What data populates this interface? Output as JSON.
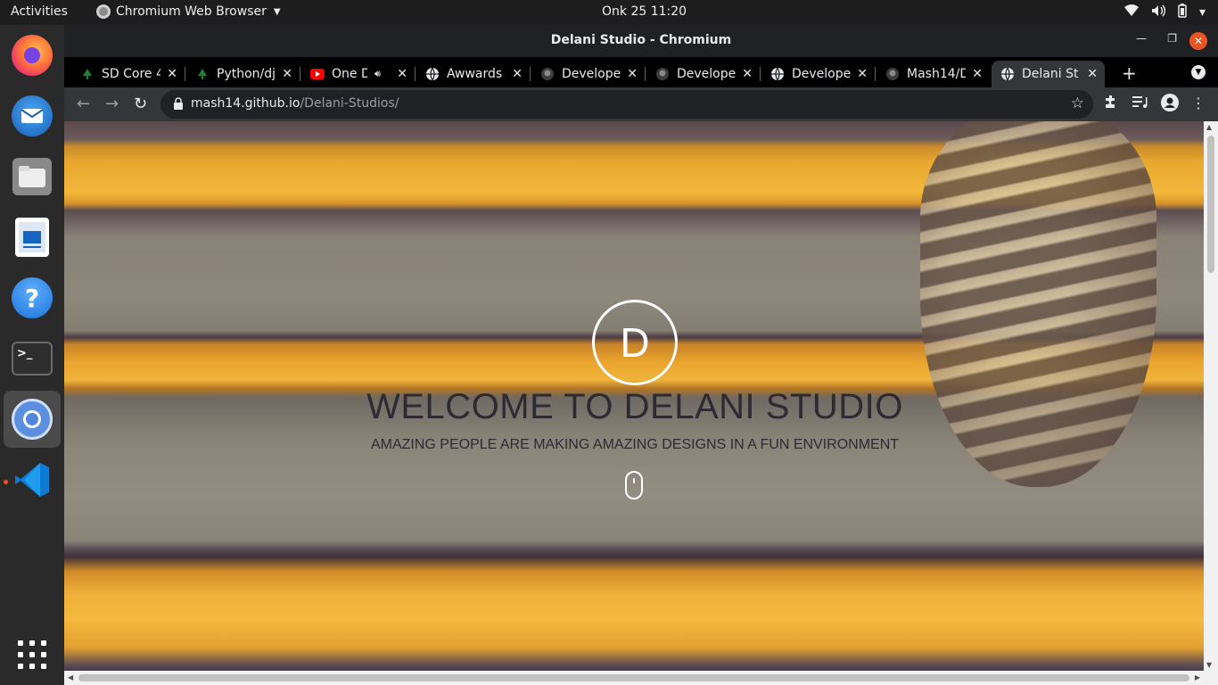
{
  "system_bar": {
    "activities": "Activities",
    "app_name": "Chromium Web Browser",
    "clock": "Onk 25  11:20"
  },
  "dock": {
    "items": [
      "firefox-icon",
      "thunderbird-icon",
      "files-icon",
      "writer-icon",
      "help-icon",
      "terminal-icon",
      "chromium-icon",
      "vscode-icon"
    ],
    "active_item": "chromium-icon"
  },
  "window": {
    "title": "Delani Studio - Chromium"
  },
  "tabs": [
    {
      "label": "SD Core 4",
      "favicon": "tree-icon"
    },
    {
      "label": "Python/dj",
      "favicon": "tree-icon"
    },
    {
      "label": "One D",
      "favicon": "youtube-icon",
      "audio": true
    },
    {
      "label": "Awwards",
      "favicon": "globe-icon"
    },
    {
      "label": "Develope",
      "favicon": "github-icon"
    },
    {
      "label": "Develope",
      "favicon": "github-icon"
    },
    {
      "label": "Develope",
      "favicon": "globe-icon"
    },
    {
      "label": "Mash14/D",
      "favicon": "github-icon"
    },
    {
      "label": "Delani St",
      "favicon": "globe-icon",
      "active": true
    }
  ],
  "omnibox": {
    "host": "mash14.github.io",
    "path": "/Delani-Studios/"
  },
  "hero": {
    "logo_letter": "D",
    "title": "WELCOME TO DELANI STUDIO",
    "subtitle": "AMAZING PEOPLE ARE MAKING AMAZING DESIGNS IN A FUN ENVIRONMENT"
  },
  "colors": {
    "accent": "#e95420",
    "stripe_yellow": "#f2b73a"
  }
}
